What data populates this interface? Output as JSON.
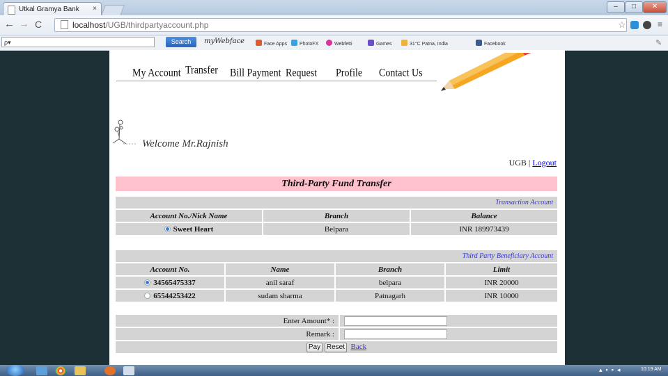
{
  "browser": {
    "tab_title": "Utkal Gramya Bank",
    "tab_close": "×",
    "url_host": "localhost",
    "url_path": "/UGB/thirdpartyaccount.php",
    "search_placeholder": "ρ▾",
    "search_button": "Search",
    "toolbar_brand": "myWebface",
    "toolbar_items": [
      "Face Apps",
      "PhotoFX",
      "Webfetti",
      "Games",
      "31°C Patna, India",
      "Facebook"
    ],
    "min_label": "–",
    "max_label": "□",
    "close_label": "✕"
  },
  "nav": {
    "items": [
      "My Account",
      "Transfer",
      "Bill Payment",
      "Request",
      "Profile",
      "Contact Us"
    ]
  },
  "welcome": "Welcome Mr.Rajnish",
  "userbar": {
    "bank": "UGB",
    "sep": "|",
    "logout": "Logout"
  },
  "transfer": {
    "title": "Third-Party Fund Transfer",
    "txn_section": "Transaction Account",
    "txn_headers": [
      "Account No./Nick Name",
      "Branch",
      "Balance"
    ],
    "txn_row": {
      "name": "Sweet Heart",
      "branch": "Belpara",
      "balance": "INR 189973439"
    },
    "ben_section": "Third Party Beneficiary Account",
    "ben_headers": [
      "Account No.",
      "Name",
      "Branch",
      "Limit"
    ],
    "ben_rows": [
      {
        "acct": "34565475337",
        "name": "anil saraf",
        "branch": "belpara",
        "limit": "INR 20000",
        "selected": true
      },
      {
        "acct": "65544253422",
        "name": "sudam sharma",
        "branch": "Patnagarh",
        "limit": "INR 10000",
        "selected": false
      }
    ],
    "amount_label": "Enter Amount* :",
    "remark_label": "Remark :",
    "pay": "Pay",
    "reset": "Reset",
    "back": "Back"
  },
  "taskbar": {
    "clock": "10:19 AM"
  }
}
